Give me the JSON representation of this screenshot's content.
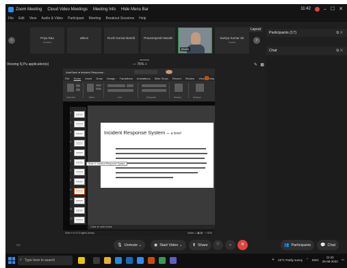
{
  "titlebar": {
    "app": "Zoom Meeting",
    "items": [
      "Cloud Video Meetings",
      "Meeting Info",
      "Hide Menu Bar"
    ],
    "time": "11:42",
    "controls": [
      "–",
      "☐",
      "✕"
    ]
  },
  "menubar": [
    "File",
    "Edit",
    "View",
    "Audio & Video",
    "Participant",
    "Meeting",
    "Breakout Sessions",
    "Help"
  ],
  "participants_strip": {
    "tiles": [
      {
        "name": "Priya Rao",
        "sub": "Ontario"
      },
      {
        "name": "wilson",
        "sub": ""
      },
      {
        "name": "Ruchi Kumar Bandit",
        "sub": ""
      },
      {
        "name": "Praveenjunsh Bandit",
        "sub": ""
      },
      {
        "name": "(Host)",
        "sub": "",
        "video": true
      },
      {
        "name": "Saritya Kumar Sir",
        "sub": "Guest"
      }
    ],
    "layout_label": "Layout"
  },
  "viewing": {
    "label": "Viewing 5j Pu application(s)",
    "zoom": "—  76%  +"
  },
  "panels": {
    "participants": "Participants (17)",
    "chat": "Chat"
  },
  "powerpoint": {
    "title": "AutoSave  ●  Incident Response...",
    "tabs": [
      "File",
      "Home",
      "Insert",
      "Draw",
      "Design",
      "Transitions",
      "Animations",
      "Slide Show",
      "Record",
      "Review",
      "View",
      "Help"
    ],
    "ribbon_groups": [
      "Clipboard",
      "Slides",
      "Font",
      "Paragraph",
      "Drawing",
      "Designer"
    ],
    "slide_numbers": [
      "1",
      "2",
      "3",
      "4",
      "5",
      "6",
      "7",
      "8",
      "9",
      "10",
      "11",
      "12"
    ],
    "tooltip": "Slide 9: Incident Response System",
    "slide_title": "Incident Response System –",
    "slide_title_handwritten": "a brief",
    "notes": "Click to add notes",
    "status_left": "Slide 9 of 12   English (India)",
    "status_right": "Notes   ▭   ▦   ▤   −  +  62%"
  },
  "controls": {
    "unmute": "Unmute",
    "start_video": "Start Video",
    "share": "Share",
    "participants": "Participants",
    "chat": "Chat"
  },
  "taskbar": {
    "search_placeholder": "Type here to search",
    "weather": "23°C  Partly sunny",
    "lang": "ENG",
    "time": "11:42",
    "date": "25-08-2022"
  }
}
